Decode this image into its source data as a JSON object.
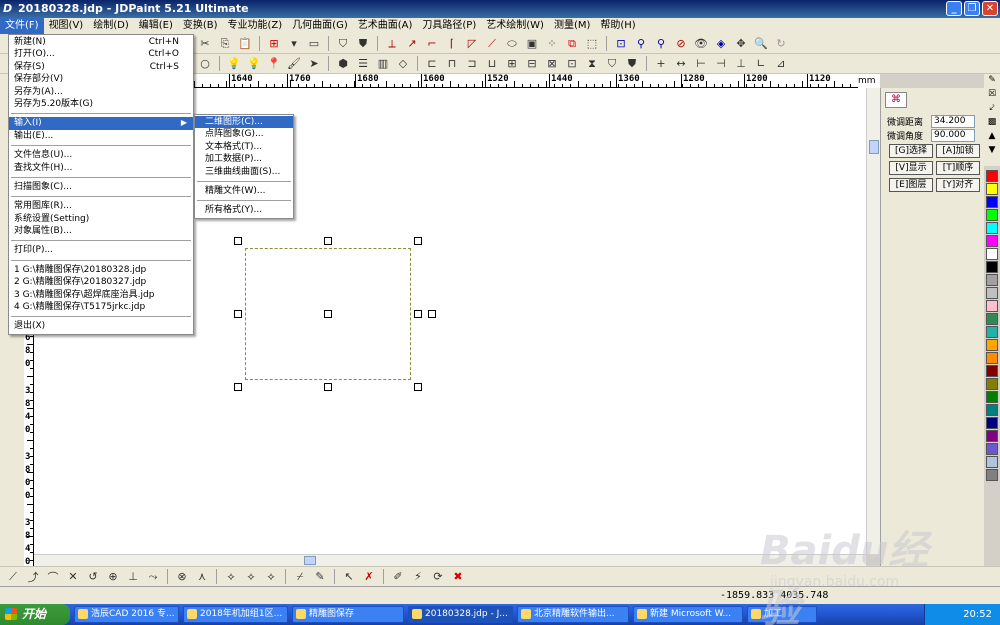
{
  "window": {
    "title": "20180328.jdp - JDPaint 5.21 Ultimate",
    "controls": [
      "_",
      "❐",
      "✕"
    ]
  },
  "menubar": [
    "文件(F)",
    "视图(V)",
    "绘制(D)",
    "编辑(E)",
    "变换(B)",
    "专业功能(Z)",
    "几何曲面(G)",
    "艺术曲面(A)",
    "刀具路径(P)",
    "艺术绘制(W)",
    "测量(M)",
    "帮助(H)"
  ],
  "file_menu": {
    "items": [
      {
        "label": "新建(N)",
        "shortcut": "Ctrl+N"
      },
      {
        "label": "打开(O)...",
        "shortcut": "Ctrl+O"
      },
      {
        "label": "保存(S)",
        "shortcut": "Ctrl+S"
      },
      {
        "label": "保存部分(V)",
        "shortcut": ""
      },
      {
        "label": "另存为(A)...",
        "shortcut": ""
      },
      {
        "label": "另存为5.20版本(G)",
        "shortcut": ""
      },
      {
        "sep": true
      },
      {
        "label": "输入(I)",
        "shortcut": "",
        "submenu": true,
        "highlighted": true
      },
      {
        "label": "输出(E)...",
        "shortcut": ""
      },
      {
        "sep": true
      },
      {
        "label": "文件信息(U)...",
        "shortcut": ""
      },
      {
        "label": "查找文件(H)...",
        "shortcut": ""
      },
      {
        "sep": true
      },
      {
        "label": "扫描图象(C)...",
        "shortcut": ""
      },
      {
        "sep": true
      },
      {
        "label": "常用图库(R)...",
        "shortcut": ""
      },
      {
        "label": "系统设置(Setting)",
        "shortcut": ""
      },
      {
        "label": "对象属性(B)...",
        "shortcut": ""
      },
      {
        "sep": true
      },
      {
        "label": "打印(P)...",
        "shortcut": ""
      },
      {
        "sep": true
      },
      {
        "label": "1 G:\\精雕图保存\\20180328.jdp",
        "shortcut": ""
      },
      {
        "label": "2 G:\\精雕图保存\\20180327.jdp",
        "shortcut": ""
      },
      {
        "label": "3 G:\\精雕图保存\\超焊底座治具.jdp",
        "shortcut": ""
      },
      {
        "label": "4 G:\\精雕图保存\\T5175jrkc.jdp",
        "shortcut": ""
      },
      {
        "sep": true
      },
      {
        "label": "退出(X)",
        "shortcut": ""
      }
    ]
  },
  "input_submenu": {
    "items": [
      {
        "label": "二维图形(C)...",
        "highlighted": true
      },
      {
        "label": "点阵图象(G)..."
      },
      {
        "label": "文本格式(T)..."
      },
      {
        "label": "加工数据(P)..."
      },
      {
        "label": "三维曲线曲面(S)..."
      },
      {
        "sep": true
      },
      {
        "label": "精雕文件(W)..."
      },
      {
        "sep": true
      },
      {
        "label": "所有格式(Y)..."
      }
    ]
  },
  "ruler": {
    "unit": "mm",
    "top_labels": [
      "1640",
      "1760",
      "1680",
      "1600",
      "1520",
      "1440",
      "1360",
      "1280",
      "1200",
      "1120"
    ],
    "left_digits": [
      "3",
      "6",
      "8",
      "0",
      "3",
      "8",
      "4",
      "0",
      "3",
      "8",
      "0",
      "0",
      "3",
      "8",
      "4",
      "0",
      "3",
      "4"
    ]
  },
  "right_panel": {
    "fields": [
      {
        "label": "微调距离",
        "value": "34.200"
      },
      {
        "label": "微调角度",
        "value": "90.000"
      }
    ],
    "buttons": [
      [
        "[G]选择",
        "[A]加锁"
      ],
      [
        "[V]显示",
        "[T]顺序"
      ],
      [
        "[E]图层",
        "[Y]对齐"
      ]
    ]
  },
  "palette": [
    "#ff0000",
    "#ffff00",
    "#0000ff",
    "#00ff00",
    "#00ffff",
    "#ff00ff",
    "#ffffff",
    "#000000",
    "#a0a0a0",
    "#c0c0c0",
    "#ffc0cb",
    "#2e8b57",
    "#20b2aa",
    "#ffa500",
    "#ff8c00",
    "#800000",
    "#808000",
    "#008000",
    "#008080",
    "#000080",
    "#800080",
    "#6a5acd",
    "#b0c4de",
    "#808080"
  ],
  "status": {
    "coords": "-1859.833  4035.748"
  },
  "taskbar": {
    "start": "开始",
    "tasks": [
      "浩辰CAD 2016 专...",
      "2018年机加组1区...",
      "精雕图保存",
      "20180328.jdp - J...",
      "北京精雕软件输出...",
      "新建 Microsoft W...",
      "加工"
    ],
    "active_index": 3,
    "clock": "20:52"
  },
  "watermark": {
    "main": "Baidu经验",
    "sub": "jingyan.baidu.com"
  }
}
